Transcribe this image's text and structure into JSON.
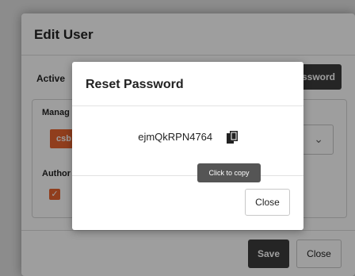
{
  "edit_user": {
    "title": "Edit User",
    "active_label": "Active",
    "password_button_label": "ssword",
    "manager_label": "Manag",
    "tag_label": "csb",
    "authorized_label": "Author",
    "save_label": "Save",
    "close_label": "Close"
  },
  "reset_modal": {
    "title": "Reset Password",
    "password_value": "ejmQkRPN4764",
    "copy_icon": "copy-icon",
    "tooltip": "Click to copy",
    "close_label": "Close"
  }
}
